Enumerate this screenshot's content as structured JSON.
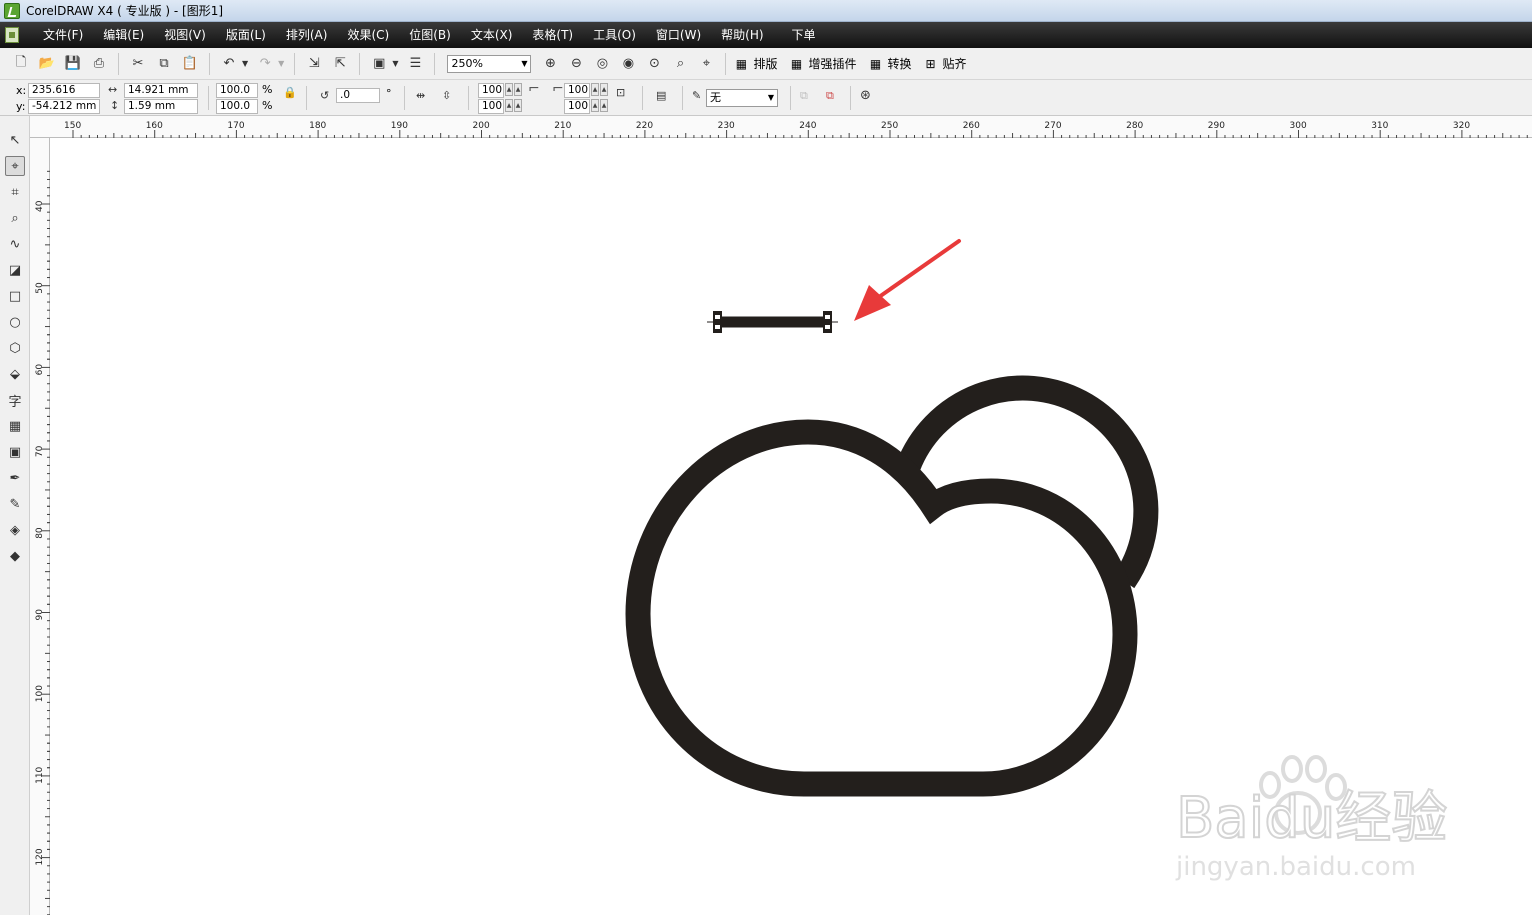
{
  "window": {
    "title": "CorelDRAW X4 ( 专业版 ) - [图形1]"
  },
  "menu": [
    {
      "id": "file",
      "label": "文件(F)"
    },
    {
      "id": "edit",
      "label": "编辑(E)"
    },
    {
      "id": "view",
      "label": "视图(V)"
    },
    {
      "id": "layout",
      "label": "版面(L)"
    },
    {
      "id": "arrange",
      "label": "排列(A)"
    },
    {
      "id": "effects",
      "label": "效果(C)"
    },
    {
      "id": "bitmaps",
      "label": "位图(B)"
    },
    {
      "id": "text",
      "label": "文本(X)"
    },
    {
      "id": "table",
      "label": "表格(T)"
    },
    {
      "id": "tools",
      "label": "工具(O)"
    },
    {
      "id": "window",
      "label": "窗口(W)"
    },
    {
      "id": "help",
      "label": "帮助(H)"
    },
    {
      "id": "order",
      "label": "下单"
    }
  ],
  "toolbar": {
    "zoom_value": "250%",
    "plugins": [
      {
        "id": "paiban",
        "label": "排版"
      },
      {
        "id": "zengqiang",
        "label": "增强插件"
      },
      {
        "id": "zhuanhuan",
        "label": "转换"
      },
      {
        "id": "tieqi",
        "label": "贴齐"
      }
    ]
  },
  "property_bar": {
    "x_label": "x:",
    "x_value": "235.616 mm",
    "y_label": "y:",
    "y_value": "-54.212 mm",
    "width_value": "14.921 mm",
    "height_value": "1.59 mm",
    "scale_x": "100.0",
    "scale_y": "100.0",
    "percent": "%",
    "rotation": ".0",
    "degree": "°",
    "node_a1": "100",
    "node_a2": "100",
    "node_b1": "100",
    "node_b2": "100",
    "outline_width": "无"
  },
  "rulers": {
    "h_labels": [
      "150",
      "160",
      "170",
      "180",
      "190",
      "200",
      "210",
      "220",
      "230",
      "240",
      "250",
      "260",
      "270",
      "280",
      "290",
      "300",
      "310",
      "320"
    ],
    "v_labels": [
      "40",
      "50",
      "60",
      "70",
      "80",
      "90",
      "100",
      "110",
      "120"
    ]
  },
  "watermark": {
    "brand": "Baidu经验",
    "url": "jingyan.baidu.com"
  },
  "colors": {
    "shape_stroke": "#231f1c",
    "arrow": "#e83a3a",
    "menubar": "#1a1a1a"
  }
}
